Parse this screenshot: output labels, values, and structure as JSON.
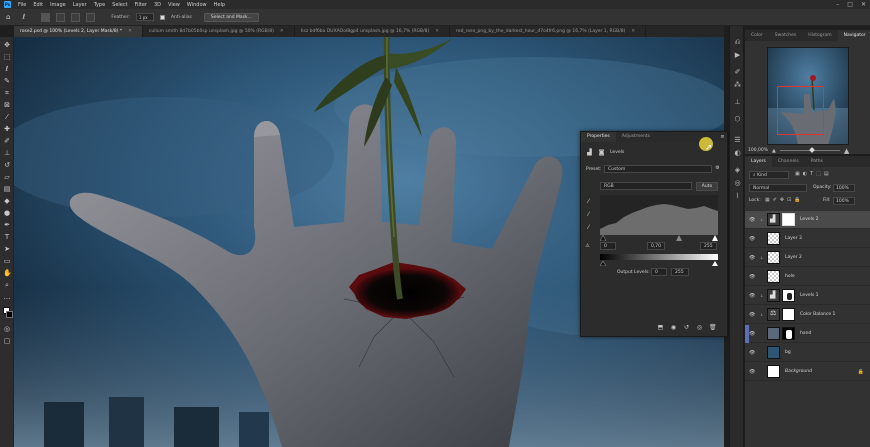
{
  "menu": [
    "File",
    "Edit",
    "Image",
    "Layer",
    "Type",
    "Select",
    "Filter",
    "3D",
    "View",
    "Window",
    "Help"
  ],
  "options": {
    "feather_label": "Feather:",
    "feather_value": "1 px",
    "antialias_label": "Anti-alias",
    "select_mask_label": "Select and Mask..."
  },
  "tabs": [
    {
      "label": "rose2.psd @ 100% (Levels 2, Layer Mask/8) *",
      "active": true
    },
    {
      "label": "cullum smith 8d7b05b0sp unsplash.jpg @ 50% (RGB/8)",
      "active": false
    },
    {
      "label": "hsz bdf6ba DUXAOol8gp4 unsplash.jpg @ 16,7% (RGB/8)",
      "active": false
    },
    {
      "label": "red_rose_png_by_the_darkest_hour_d7o4fr6.png @ 16,7% (Layer 1, RGB/8)",
      "active": false
    }
  ],
  "navigator": {
    "tabs": [
      "Color",
      "Swatches",
      "Histogram",
      "Navigator"
    ],
    "active_tab": "Navigator",
    "zoom": "100,00%"
  },
  "layers": {
    "tabs": [
      "Layers",
      "Channels",
      "Paths"
    ],
    "active_tab": "Layers",
    "filter_value": "Kind",
    "blend_mode": "Normal",
    "opacity_label": "Opacity:",
    "opacity_value": "100%",
    "lock_label": "Lock:",
    "fill_label": "Fill:",
    "fill_value": "100%",
    "items": [
      {
        "name": "Levels 2",
        "type": "adjustment",
        "clipped": true,
        "mask": true,
        "selected": true
      },
      {
        "name": "Layer 3",
        "type": "pixel",
        "clipped": false,
        "mask": false,
        "selected": false
      },
      {
        "name": "Layer 2",
        "type": "pixel",
        "clipped": true,
        "mask": false,
        "selected": false
      },
      {
        "name": "hole",
        "type": "pixel",
        "clipped": false,
        "mask": false,
        "selected": false
      },
      {
        "name": "Levels 1",
        "type": "adjustment",
        "clipped": true,
        "mask": true,
        "selected": false
      },
      {
        "name": "Color Balance 1",
        "type": "adjustment",
        "clipped": true,
        "mask": true,
        "selected": false
      },
      {
        "name": "hand",
        "type": "image",
        "clipped": false,
        "mask": true,
        "selected": false
      },
      {
        "name": "bg",
        "type": "image",
        "clipped": false,
        "mask": false,
        "selected": false
      },
      {
        "name": "Background",
        "type": "background",
        "clipped": false,
        "mask": false,
        "selected": false,
        "locked": true
      }
    ]
  },
  "properties": {
    "tabs": [
      "Properties",
      "Adjustments"
    ],
    "active_tab": "Properties",
    "title": "Levels",
    "preset_label": "Preset:",
    "preset_value": "Custom",
    "channel_value": "RGB",
    "auto_label": "Auto",
    "input_black": "0",
    "input_gamma": "0,70",
    "input_white": "255",
    "output_label": "Output Levels:",
    "output_black": "0",
    "output_white": "255"
  },
  "colors": {
    "accent": "#31a8ff",
    "panel": "#323232",
    "selected_layer": "#4a4a4a"
  }
}
